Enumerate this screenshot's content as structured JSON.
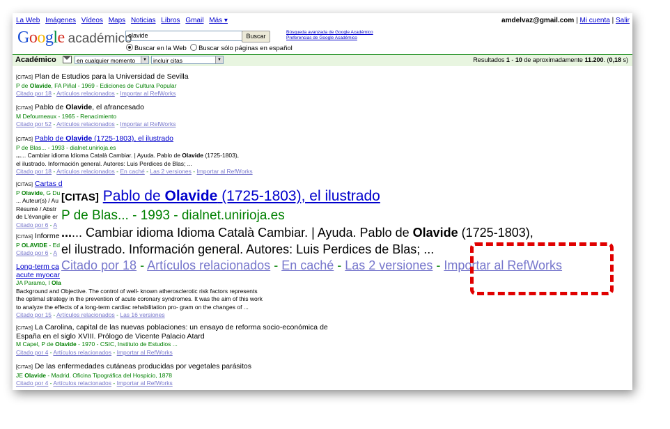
{
  "nav": {
    "items": [
      "La Web",
      "Imágenes",
      "Vídeos",
      "Maps",
      "Noticias",
      "Libros",
      "Gmail",
      "Más ▾"
    ]
  },
  "user": {
    "email": "amdelvaz@gmail.com",
    "account": "Mi cuenta",
    "signout": "Salir",
    "sep": "|"
  },
  "logo": {
    "brand": "Google",
    "product": "académico"
  },
  "search": {
    "value": "olavide",
    "button": "Buscar",
    "radio_web": "Buscar en la Web",
    "radio_spanish": "Buscar sólo páginas en español"
  },
  "advanced": {
    "advanced_search": "Búsqueda avanzada de Google Académico",
    "preferences": "Preferencias de Google Académico"
  },
  "bar": {
    "label": "Académico",
    "time_select": "en cualquier momento",
    "cites_select": "incluir citas",
    "results_prefix": "Resultados ",
    "results_range_start": "1",
    "results_range_sep": " - ",
    "results_range_end": "10",
    "results_mid": " de aproximadamente ",
    "results_total": "11.200",
    "results_time_pre": ". (",
    "results_time": "0,18",
    "results_time_post": " s)"
  },
  "tag_citas": "[CITAS]",
  "results": [
    {
      "title": "Plan de Estudios para la Universidad de Sevilla",
      "authors_pre": "P de ",
      "authors_bold": "Olavide",
      "authors_post": ", FA Piñal - 1969 - Ediciones de Cultura Popular",
      "links": [
        "Citado por 18",
        "Artículos relacionados",
        "Importar al RefWorks"
      ]
    },
    {
      "title_pre": "Pablo de ",
      "title_bold": "Olavide",
      "title_post": ", el afrancesado",
      "authors": "M Defourneaux - 1965 - Renacimiento",
      "links": [
        "Citado por 52",
        "Artículos relacionados",
        "Importar al RefWorks"
      ]
    },
    {
      "title_pre": "Pablo de ",
      "title_bold": "Olavide",
      "title_post": " (1725-1803), el ilustrado",
      "authors": "P de Blas... - 1993 - dialnet.unirioja.es",
      "snippet1_pre": "... Cambiar idioma Idioma Català Cambiar. | Ayuda. Pablo de ",
      "snippet1_bold": "Olavide",
      "snippet1_post": " (1725-1803),",
      "snippet2": "el ilustrado. Información general. Autores: Luis Perdices de Blas; ...",
      "links": [
        "Citado por 18",
        "Artículos relacionados",
        "En caché",
        "Las 2 versiones",
        "Importar al RefWorks"
      ]
    },
    {
      "title": "Cartas d",
      "authors_pre": "P ",
      "authors_bold": "Olavide",
      "authors_post": ", G Du",
      "snippet_lines": [
        "... Auteur(s) / Au",
        "Résumé / Abstr",
        "de L'évangile er"
      ],
      "links": [
        "Citado por 6",
        "A"
      ]
    },
    {
      "title": "Informe",
      "authors_pre": "P ",
      "authors_bold": "OLAVIDE",
      "authors_post": " - Ed",
      "links": [
        "Citado por 6",
        "A"
      ]
    },
    {
      "title_line1": "Long-term ca",
      "title_line2": "acute myocar",
      "authors_pre": "JA Paramo, I ",
      "authors_bold": "Ola",
      "snippet_lines": [
        "Background and Objective. The control of well- known atherosclerotic risk factors represents",
        "the optimal strategy in the prevention of acute coronary syndromes. It was the aim of this work",
        "to analyze the effects of a long-term cardiac rehabilitation pro- gram on the changes of ..."
      ],
      "links": [
        "Citado por 15",
        "Artículos relacionados",
        "Las 16 versiones"
      ]
    },
    {
      "title_line1": "La Carolina, capital de las nuevas poblaciones: un ensayo de reforma socio-económica de",
      "title_line2": "España en el siglo XVIII. Prólogo de Vicente Palacio Atard",
      "authors_pre": "M Capel, P de ",
      "authors_bold": "Olavide",
      "authors_post": " - 1970 - CSIC, Instituto de Estudios ...",
      "links": [
        "Citado por 4",
        "Artículos relacionados",
        "Importar al RefWorks"
      ]
    },
    {
      "title": "De las enfermedades cutáneas producidas por vegetales parásitos",
      "authors_pre": "JE ",
      "authors_bold": "Olavide",
      "authors_post": " - Madrid. Oficina Tipográfica del Hospicio, 1878",
      "links": [
        "Citado por 4",
        "Artículos relacionados",
        "Importar al RefWorks"
      ]
    }
  ],
  "link_sep": " - ",
  "colors": {
    "highlight_box": "#e00000",
    "link": "#0000cc",
    "visited": "#7777cc",
    "green": "#008000"
  }
}
